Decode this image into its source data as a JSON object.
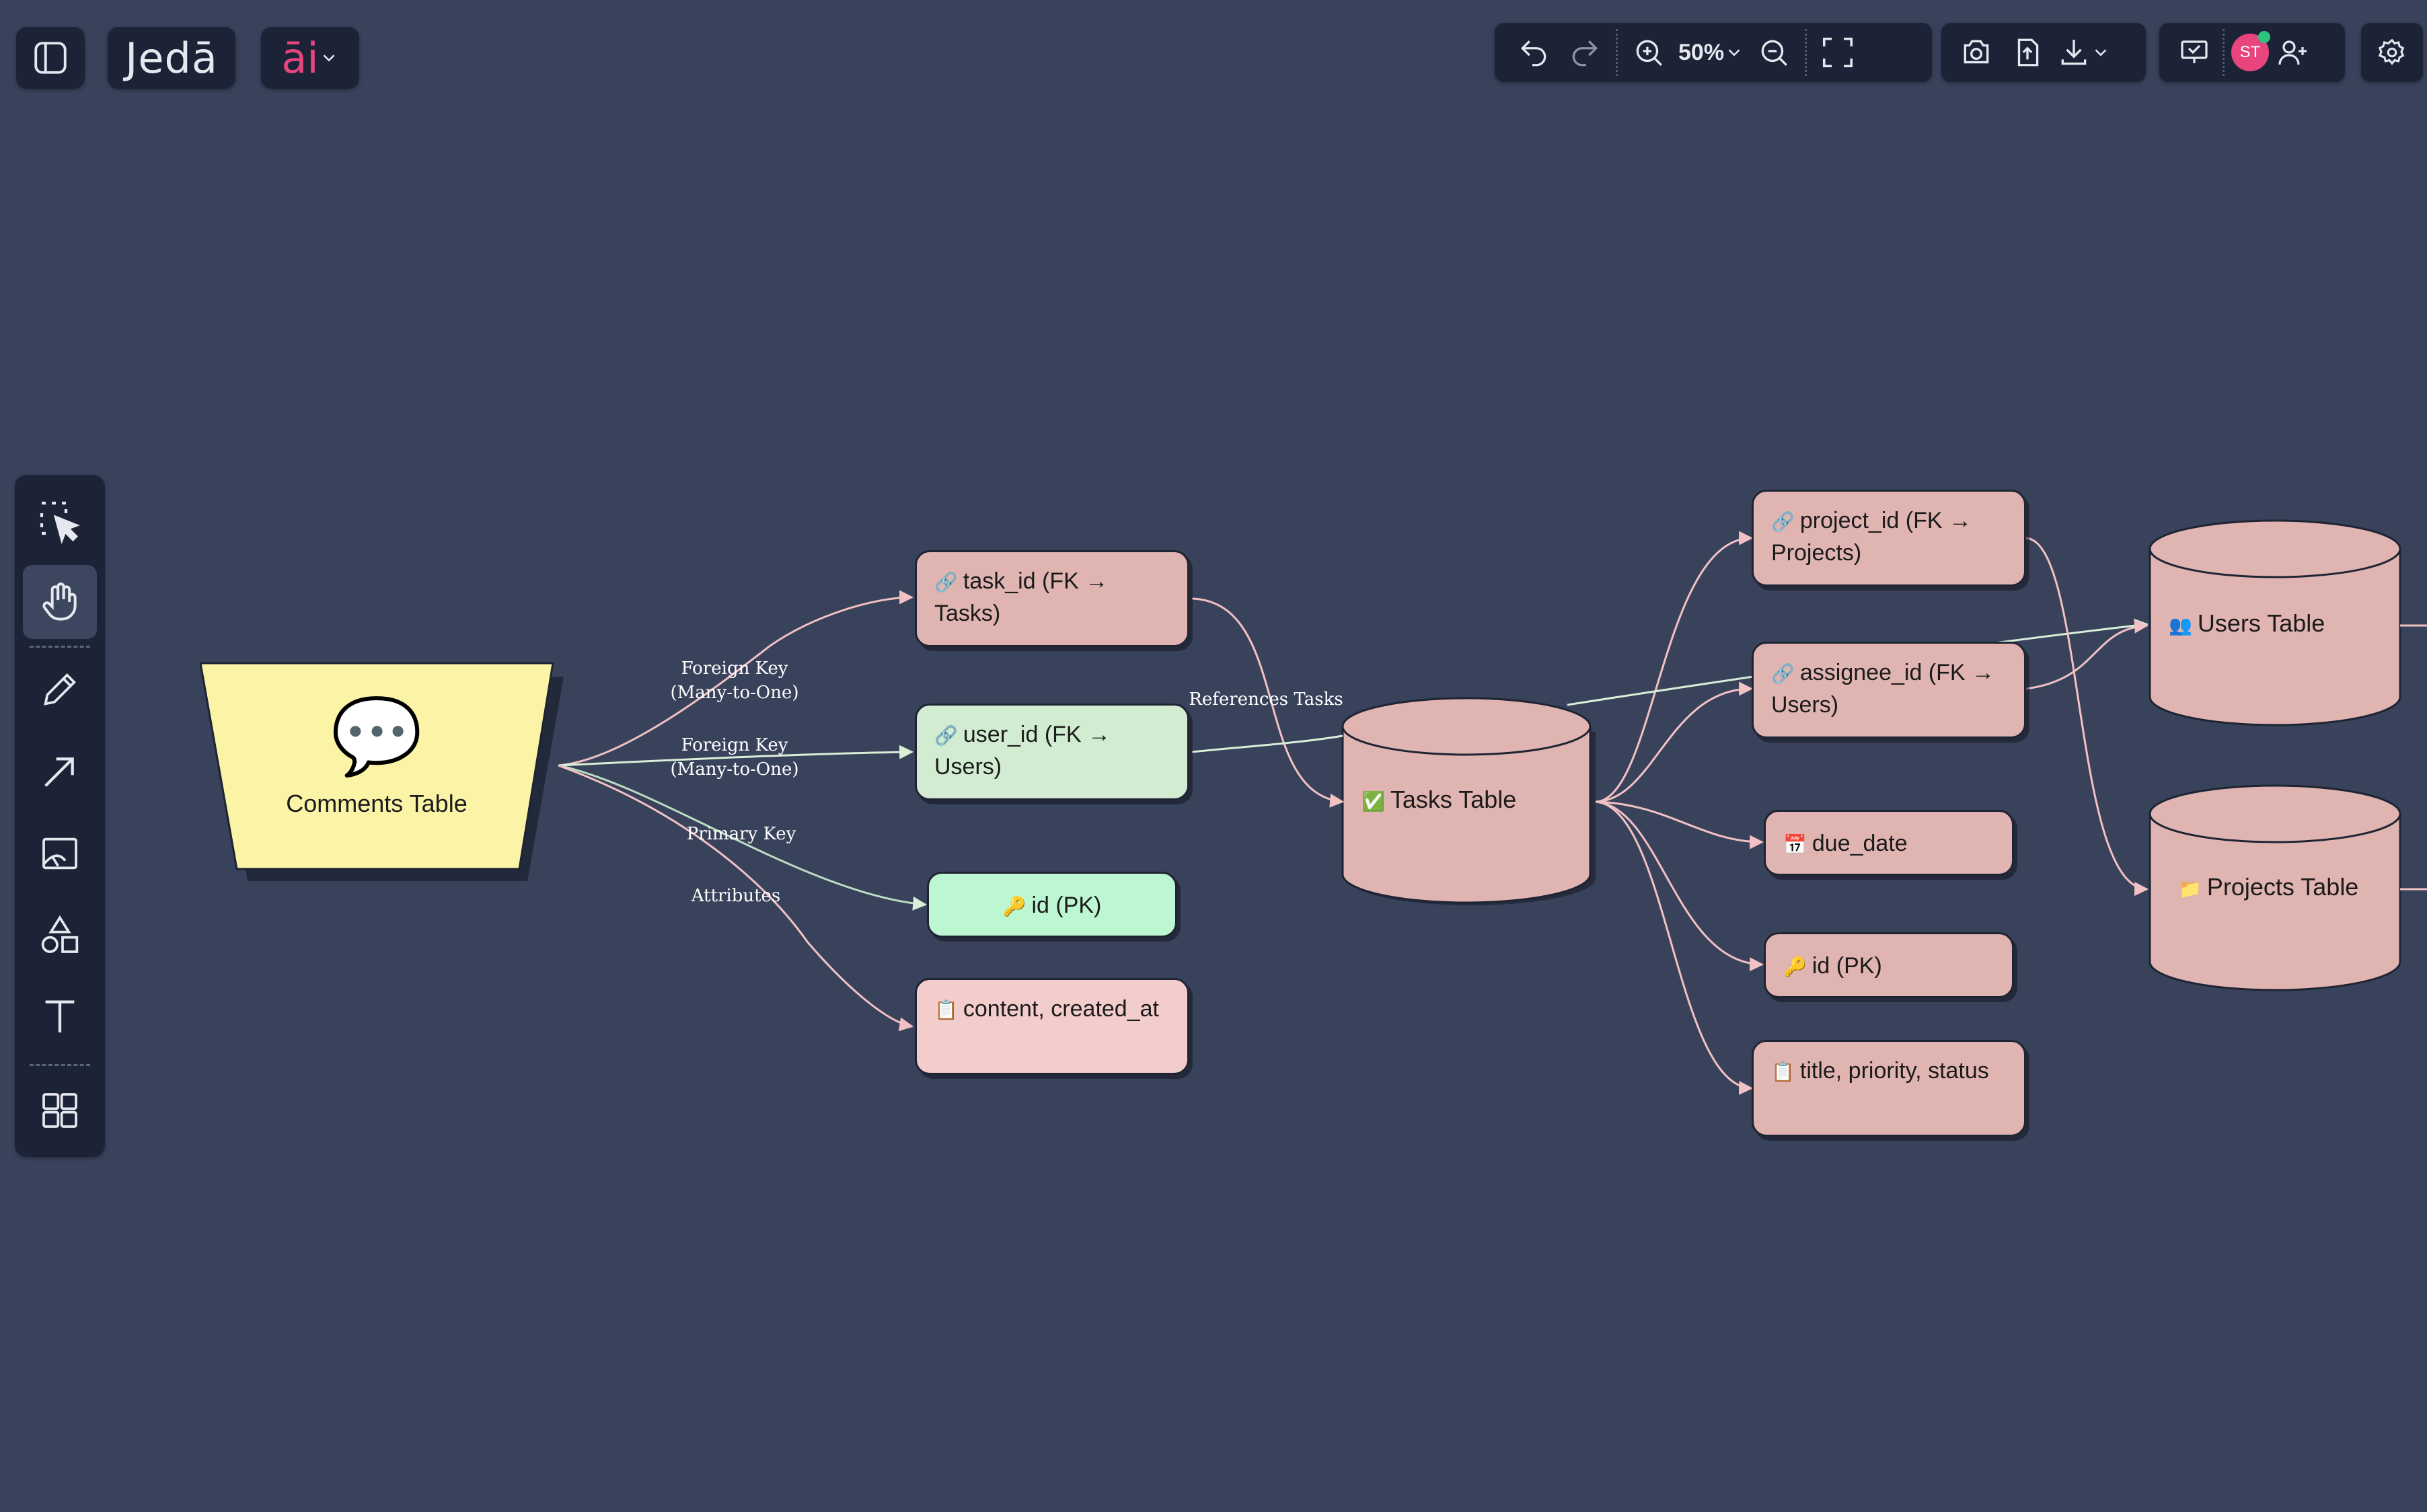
{
  "app": {
    "logo": "Jedā",
    "ai_menu": "āi"
  },
  "toolbar": {
    "zoom": "50%",
    "avatar_initials": "ST"
  },
  "left_tools": [
    "select",
    "hand",
    "pen",
    "arrow",
    "image",
    "shapes",
    "text",
    "components"
  ],
  "diagram": {
    "comments_table": {
      "icon": "💬",
      "label": "Comments Table"
    },
    "tasks_table": {
      "icon": "✅",
      "label": "Tasks Table"
    },
    "users_table": {
      "icon": "👥",
      "label": "Users Table"
    },
    "projects_table": {
      "icon": "📁",
      "label": "Projects Table"
    },
    "comment_fields": {
      "task_id": {
        "icon": "🔗",
        "label": "task_id (FK → Tasks)"
      },
      "user_id": {
        "icon": "🔗",
        "label": "user_id (FK → Users)"
      },
      "id": {
        "icon": "🔑",
        "label": "id (PK)"
      },
      "content": {
        "icon": "📋",
        "label": "content, created_at"
      }
    },
    "task_fields": {
      "project_id": {
        "icon": "🔗",
        "label": "project_id (FK → Projects)"
      },
      "assignee_id": {
        "icon": "🔗",
        "label": "assignee_id (FK → Users)"
      },
      "due_date": {
        "icon": "📅",
        "label": "due_date"
      },
      "id": {
        "icon": "🔑",
        "label": "id (PK)"
      },
      "title": {
        "icon": "📋",
        "label": "title, priority, status"
      }
    },
    "edge_labels": {
      "fk1_line1": "Foreign Key",
      "fk1_line2": "(Many-to-One)",
      "fk2_line1": "Foreign Key",
      "fk2_line2": "(Many-to-One)",
      "primary_key": "Primary Key",
      "attributes": "Attributes",
      "references_tasks": "References Tasks"
    }
  }
}
